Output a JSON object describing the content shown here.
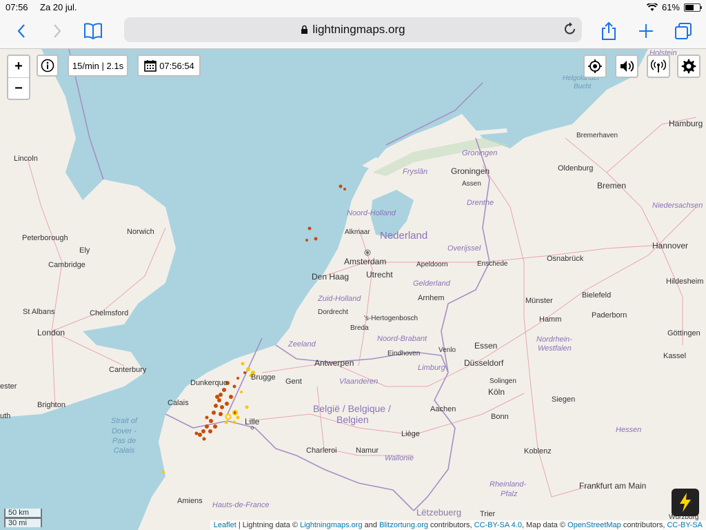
{
  "status_bar": {
    "time": "07:56",
    "date": "Za 20 jul.",
    "battery": "61%"
  },
  "browser": {
    "url": "lightningmaps.org"
  },
  "map_controls": {
    "zoom_in": "+",
    "zoom_out": "−",
    "rate": "15/min | 2.1s",
    "clock": "07:56:54"
  },
  "scale": {
    "km": "50 km",
    "mi": "30 mi"
  },
  "attribution": {
    "leaflet": "Leaflet",
    "t1": " | Lightning data © ",
    "lm": "Lightningmaps.org",
    "t2": " and ",
    "bz": "Blitzortung.org",
    "t3": " contributors, ",
    "cc1": "CC-BY-SA 4.0",
    "t4": ", Map data © ",
    "osm": "OpenStreetMap",
    "t5": " contributors, ",
    "cc2": "CC-BY-SA"
  },
  "labels": {
    "cities": {
      "lincoln": "Lincoln",
      "peterborough": "Peterborough",
      "norwich": "Norwich",
      "ely": "Ely",
      "cambridge": "Cambridge",
      "st_albans": "St Albans",
      "chelmsford": "Chelmsford",
      "london": "London",
      "canterbury": "Canterbury",
      "brighton": "Brighton",
      "chester": "ester",
      "south": "uth",
      "dunkerque": "Dunkerque",
      "calais": "Calais",
      "brugge": "Brugge",
      "gent": "Gent",
      "lille": "Lille",
      "antwerpen": "Antwerpen",
      "amiens": "Amiens",
      "charleroi": "Charleroi",
      "namur": "Namur",
      "liege": "Liège",
      "aachen": "Aachen",
      "koln": "Köln",
      "bonn": "Bonn",
      "koblenz": "Koblenz",
      "siegen": "Siegen",
      "frankfurt": "Frankfurt am Main",
      "trier": "Trier",
      "wurzburg": "Würzburg",
      "kassel": "Kassel",
      "gottingen": "Göttingen",
      "paderborn": "Paderborn",
      "hamm": "Hamm",
      "munster": "Münster",
      "bielefeld": "Bielefeld",
      "hildesheim": "Hildesheim",
      "hannover": "Hannover",
      "osnabruck": "Osnabrück",
      "bremen": "Bremen",
      "oldenburg": "Oldenburg",
      "bremerhaven": "Bremerhaven",
      "hamburg": "Hamburg",
      "groningen": "Groningen",
      "assen": "Assen",
      "alkmaar": "Alkmaar",
      "amsterdam": "Amsterdam",
      "den_haag": "Den Haag",
      "utrecht": "Utrecht",
      "apeldoorn": "Apeldoorn",
      "enschede": "Enschede",
      "arnhem": "Arnhem",
      "dordrecht": "Dordrecht",
      "breda": "Breda",
      "hertogenbosch": "'s-Hertogenbosch",
      "eindhoven": "Eindhoven",
      "venlo": "Venlo",
      "essen": "Essen",
      "dusseldorf": "Düsseldorf",
      "solingen": "Solingen",
      "letzebuerg": "Lëtzebuerg"
    },
    "regions": {
      "groningen_p": "Groningen",
      "fryslan": "Fryslân",
      "drenthe": "Drenthe",
      "noord_holland": "Noord-Holland",
      "overijssel": "Overijssel",
      "gelderland": "Gelderland",
      "zuid_holland": "Zuid-Holland",
      "zeeland": "Zeeland",
      "noord_brabant": "Noord-Brabant",
      "limburg": "Limburg",
      "vlaanderen": "Vlaanderen",
      "wallonie": "Wallonie",
      "hauts_de_france": "Hauts-de-France",
      "nrw1": "Nordrhein-",
      "nrw2": "Westfalen",
      "hessen": "Hessen",
      "rp1": "Rheinland-",
      "rp2": "Pfalz",
      "niedersachsen": "Niedersachsen",
      "holstein": "Holstein",
      "helgolander1": "Helgoländer",
      "helgolander2": "Bucht"
    },
    "countries": {
      "nederland": "Nederland",
      "belgie1": "België / Belgique /",
      "belgie2": "Belgien"
    },
    "sea": {
      "strait1": "Strait of",
      "strait2": "Dover -",
      "strait3": "Pas de",
      "strait4": "Calais"
    }
  },
  "colors": {
    "sea": "#aad3df",
    "land": "#f2efe9",
    "border": "#a68fc4",
    "road": "#e892a2",
    "strike_recent": "#ffc400",
    "strike_old": "#c84c00"
  }
}
